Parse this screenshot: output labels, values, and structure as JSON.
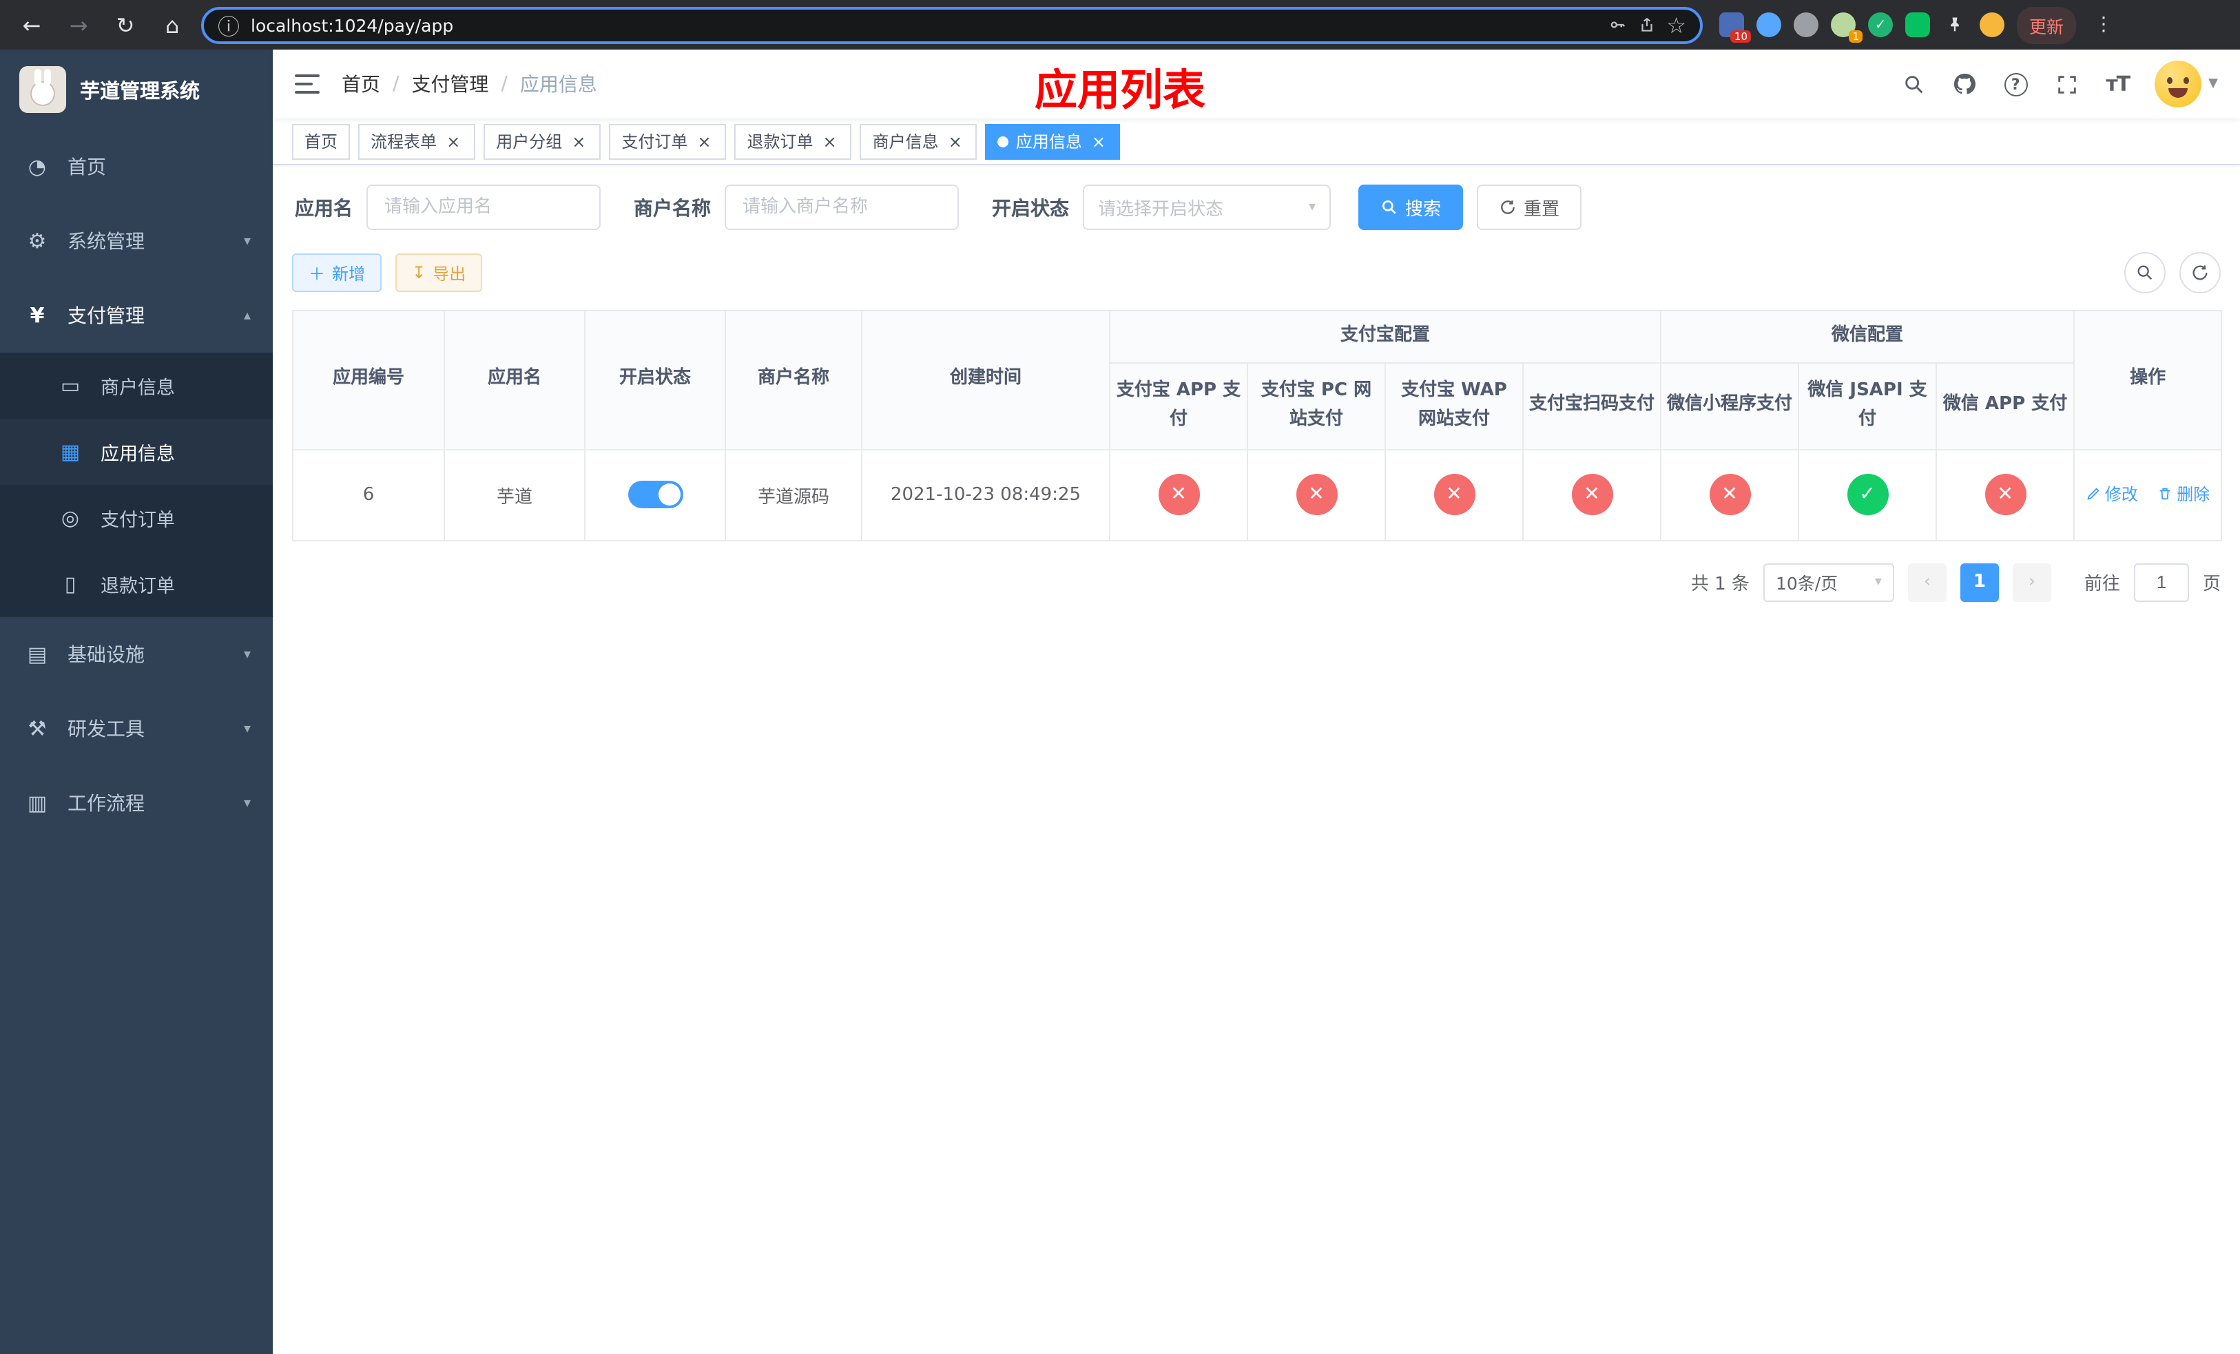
{
  "browser": {
    "url": "localhost:1024/pay/app",
    "update_label": "更新",
    "extensions_badge": "10",
    "avatar_badge": "1"
  },
  "sidebar": {
    "app_title": "芋道管理系统",
    "items": [
      {
        "label": "首页"
      },
      {
        "label": "系统管理"
      },
      {
        "label": "支付管理",
        "children": [
          {
            "label": "商户信息"
          },
          {
            "label": "应用信息"
          },
          {
            "label": "支付订单"
          },
          {
            "label": "退款订单"
          }
        ]
      },
      {
        "label": "基础设施"
      },
      {
        "label": "研发工具"
      },
      {
        "label": "工作流程"
      }
    ]
  },
  "header": {
    "breadcrumb": [
      "首页",
      "支付管理",
      "应用信息"
    ],
    "page_title": "应用列表"
  },
  "tabs": [
    {
      "label": "首页"
    },
    {
      "label": "流程表单"
    },
    {
      "label": "用户分组"
    },
    {
      "label": "支付订单"
    },
    {
      "label": "退款订单"
    },
    {
      "label": "商户信息"
    },
    {
      "label": "应用信息"
    }
  ],
  "filters": {
    "app_name_label": "应用名",
    "app_name_placeholder": "请输入应用名",
    "merchant_label": "商户名称",
    "merchant_placeholder": "请输入商户名称",
    "status_label": "开启状态",
    "status_placeholder": "请选择开启状态",
    "search_button": "搜索",
    "reset_button": "重置"
  },
  "toolbar": {
    "add_button": "新增",
    "export_button": "导出"
  },
  "table": {
    "headers": {
      "id": "应用编号",
      "name": "应用名",
      "status": "开启状态",
      "merchant": "商户名称",
      "created": "创建时间",
      "alipay_group": "支付宝配置",
      "wechat_group": "微信配置",
      "alipay": [
        "支付宝 APP 支付",
        "支付宝 PC 网站支付",
        "支付宝 WAP 网站支付",
        "支付宝扫码支付"
      ],
      "wechat": [
        "微信小程序支付",
        "微信 JSAPI 支付",
        "微信 APP 支付"
      ],
      "actions": "操作"
    },
    "rows": [
      {
        "id": "6",
        "name": "芋道",
        "enabled": true,
        "merchant": "芋道源码",
        "created": "2021-10-23 08:49:25",
        "alipay_app": false,
        "alipay_pc": false,
        "alipay_wap": false,
        "alipay_qr": false,
        "wx_lite": false,
        "wx_jsapi": true,
        "wx_app": false,
        "edit": "修改",
        "delete": "删除"
      }
    ]
  },
  "pagination": {
    "total": "共 1 条",
    "page_size": "10条/页",
    "page": "1",
    "goto": "前往",
    "unit": "页"
  }
}
